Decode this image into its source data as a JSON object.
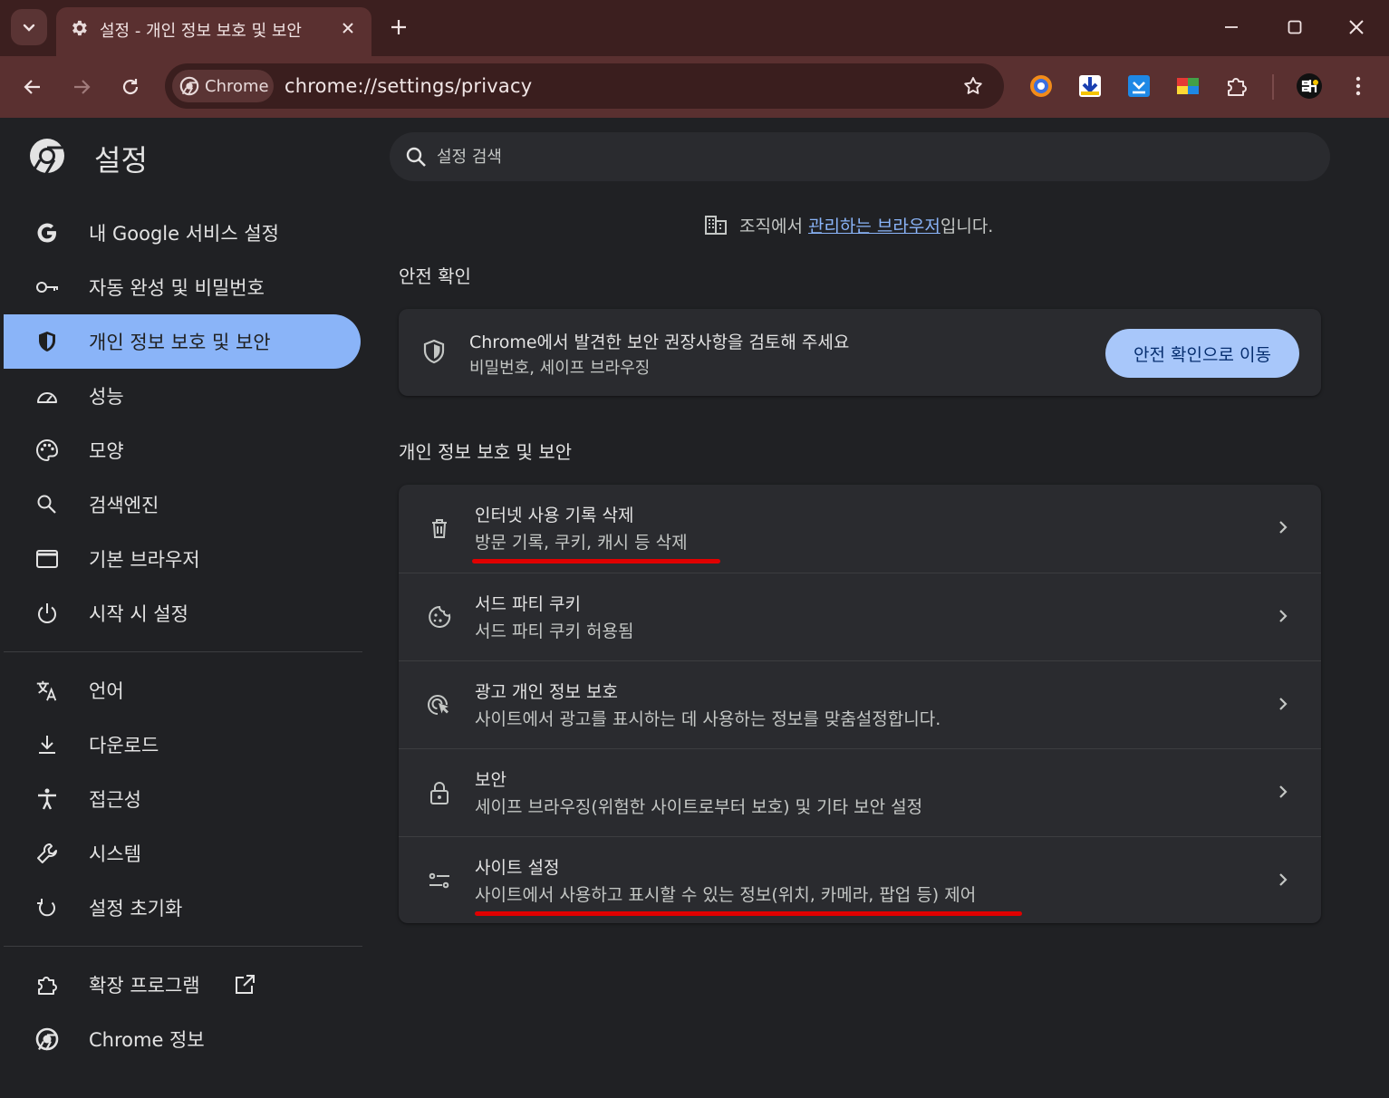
{
  "tab": {
    "title": "설정 - 개인 정보 보호 및 보안"
  },
  "omnibox": {
    "chip_label": "Chrome",
    "url": "chrome://settings/privacy"
  },
  "header": {
    "title": "설정",
    "search_placeholder": "설정 검색"
  },
  "sidebar": {
    "items": [
      {
        "label": "내 Google 서비스 설정",
        "icon": "google-icon"
      },
      {
        "label": "자동 완성 및 비밀번호",
        "icon": "key-icon"
      },
      {
        "label": "개인 정보 보호 및 보안",
        "icon": "shield-icon",
        "active": true
      },
      {
        "label": "성능",
        "icon": "speedometer-icon"
      },
      {
        "label": "모양",
        "icon": "palette-icon"
      },
      {
        "label": "검색엔진",
        "icon": "search-icon"
      },
      {
        "label": "기본 브라우저",
        "icon": "browser-window-icon"
      },
      {
        "label": "시작 시 설정",
        "icon": "power-icon"
      },
      {
        "label": "언어",
        "icon": "translate-icon"
      },
      {
        "label": "다운로드",
        "icon": "download-icon"
      },
      {
        "label": "접근성",
        "icon": "accessibility-icon"
      },
      {
        "label": "시스템",
        "icon": "wrench-icon"
      },
      {
        "label": "설정 초기화",
        "icon": "reset-icon"
      },
      {
        "label": "확장 프로그램",
        "icon": "puzzle-icon"
      },
      {
        "label": "Chrome 정보",
        "icon": "chrome-logo-icon"
      }
    ]
  },
  "managed": {
    "prefix": "조직에서 ",
    "link": "관리하는 브라우저",
    "suffix": "입니다."
  },
  "safety_check": {
    "section_title": "안전 확인",
    "title": "Chrome에서 발견한 보안 권장사항을 검토해 주세요",
    "subtitle": "비밀번호, 세이프 브라우징",
    "button_label": "안전 확인으로 이동"
  },
  "privacy": {
    "section_title": "개인 정보 보호 및 보안",
    "rows": [
      {
        "title": "인터넷 사용 기록 삭제",
        "subtitle": "방문 기록, 쿠키, 캐시 등 삭제",
        "icon": "trash-icon"
      },
      {
        "title": "서드 파티 쿠키",
        "subtitle": "서드 파티 쿠키 허용됨",
        "icon": "cookie-icon"
      },
      {
        "title": "광고 개인 정보 보호",
        "subtitle": "사이트에서 광고를 표시하는 데 사용하는 정보를 맞춤설정합니다.",
        "icon": "ad-privacy-icon"
      },
      {
        "title": "보안",
        "subtitle": "세이프 브라우징(위험한 사이트로부터 보호) 및 기타 보안 설정",
        "icon": "lock-icon"
      },
      {
        "title": "사이트 설정",
        "subtitle": "사이트에서 사용하고 표시할 수 있는 정보(위치, 카메라, 팝업 등) 제어",
        "icon": "sliders-icon"
      }
    ]
  },
  "colors": {
    "accent": "#8ab4f8",
    "button": "#a8c7fa",
    "frame": "#5a3030",
    "annotation": "#e00000"
  }
}
